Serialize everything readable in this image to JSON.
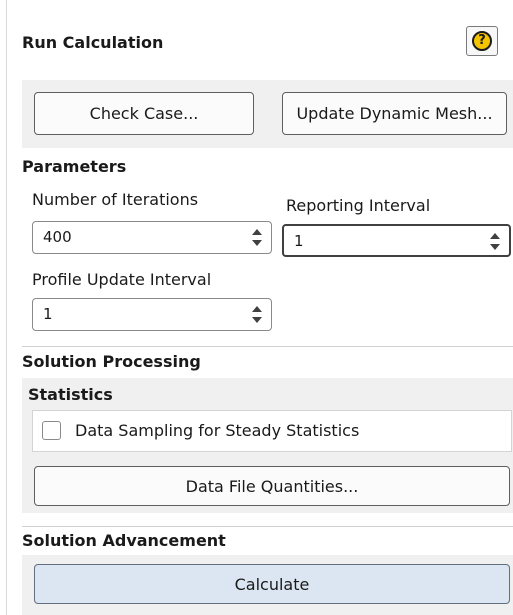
{
  "header": {
    "title": "Run Calculation",
    "help_icon": "help-icon",
    "help_symbol": "?"
  },
  "actions": {
    "check_case": "Check Case...",
    "update_dynamic_mesh": "Update Dynamic Mesh..."
  },
  "parameters": {
    "section_title": "Parameters",
    "iterations_label": "Number of Iterations",
    "iterations_value": "400",
    "reporting_label": "Reporting Interval",
    "reporting_value": "1",
    "profile_label": "Profile Update Interval",
    "profile_value": "1"
  },
  "solution_processing": {
    "section_title": "Solution Processing",
    "statistics_title": "Statistics",
    "data_sampling_label": "Data Sampling for Steady Statistics",
    "data_sampling_checked": false,
    "data_file_quantities": "Data File Quantities..."
  },
  "solution_advancement": {
    "section_title": "Solution Advancement",
    "calculate": "Calculate"
  },
  "colors": {
    "panel_bg": "#f0f0f0",
    "help_icon_fill": "#f5c400",
    "calculate_bg": "#dbe6f2"
  }
}
